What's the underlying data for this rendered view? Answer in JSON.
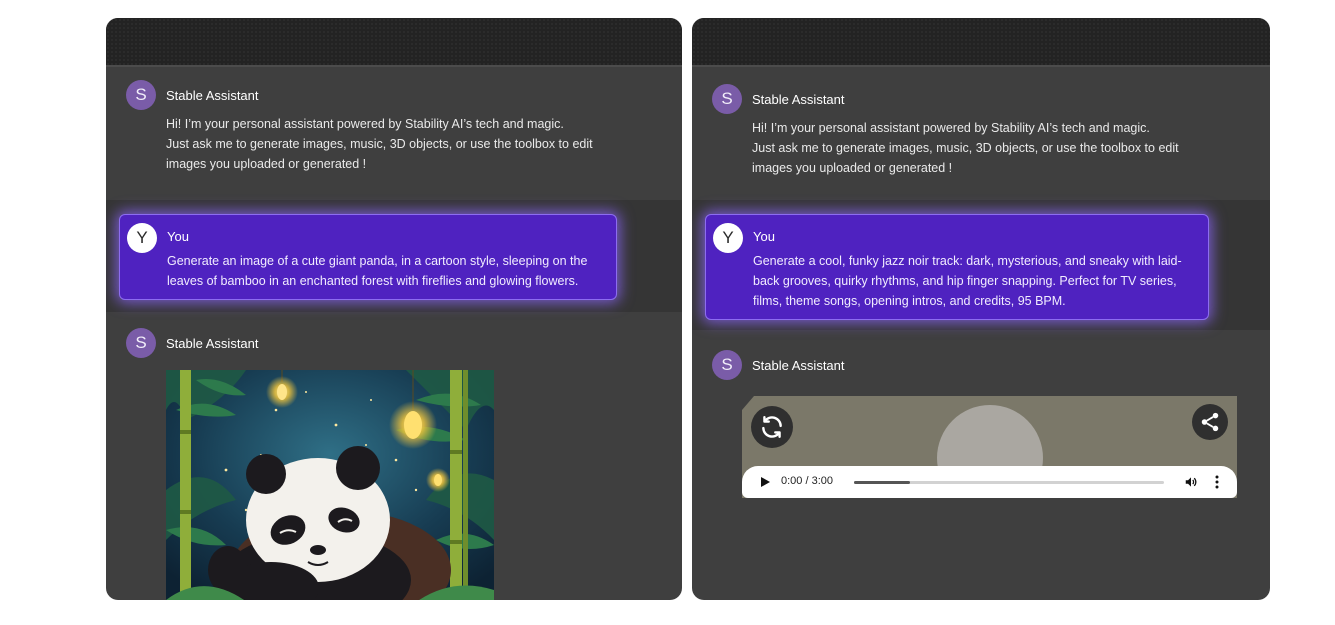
{
  "left_panel": {
    "assistant_intro": {
      "avatar_letter": "S",
      "sender": "Stable Assistant",
      "lines": [
        "Hi! I’m your personal assistant powered by Stability AI’s tech and magic.",
        "Just ask me to generate images, music, 3D objects, or use the toolbox to edit",
        "images you uploaded or generated !"
      ]
    },
    "user_message": {
      "avatar_letter": "Y",
      "sender": "You",
      "lines": [
        "Generate an image of a cute giant panda, in a cartoon style, sleeping on the",
        "leaves of bamboo in an enchanted forest with fireflies and glowing flowers."
      ]
    },
    "assistant_reply": {
      "avatar_letter": "S",
      "sender": "Stable Assistant",
      "image_subject": "panda-sleeping-bamboo-forest"
    }
  },
  "right_panel": {
    "assistant_intro": {
      "avatar_letter": "S",
      "sender": "Stable Assistant",
      "lines": [
        "Hi! I’m your personal assistant powered by Stability AI’s tech and magic.",
        "Just ask me to generate images, music, 3D objects, or use the toolbox to edit",
        "images you uploaded or generated !"
      ]
    },
    "user_message": {
      "avatar_letter": "Y",
      "sender": "You",
      "lines": [
        "Generate a cool, funky jazz noir track: dark, mysterious, and sneaky with laid-",
        "back grooves, quirky rhythms, and hip finger snapping. Perfect for TV series,",
        "films, theme songs, opening intros, and credits, 95 BPM."
      ]
    },
    "assistant_reply": {
      "avatar_letter": "S",
      "sender": "Stable Assistant",
      "audio": {
        "time": "0:00 / 3:00",
        "progress_fraction": 0.18,
        "icons": [
          "replay-icon",
          "share-icon",
          "play-icon",
          "volume-icon",
          "more-options-icon"
        ]
      }
    }
  },
  "colors": {
    "panel_bg": "#3f3f3f",
    "user_card": "#4f22c0",
    "assistant_avatar": "#7a5ca8",
    "audio_card": "#7b7869"
  }
}
